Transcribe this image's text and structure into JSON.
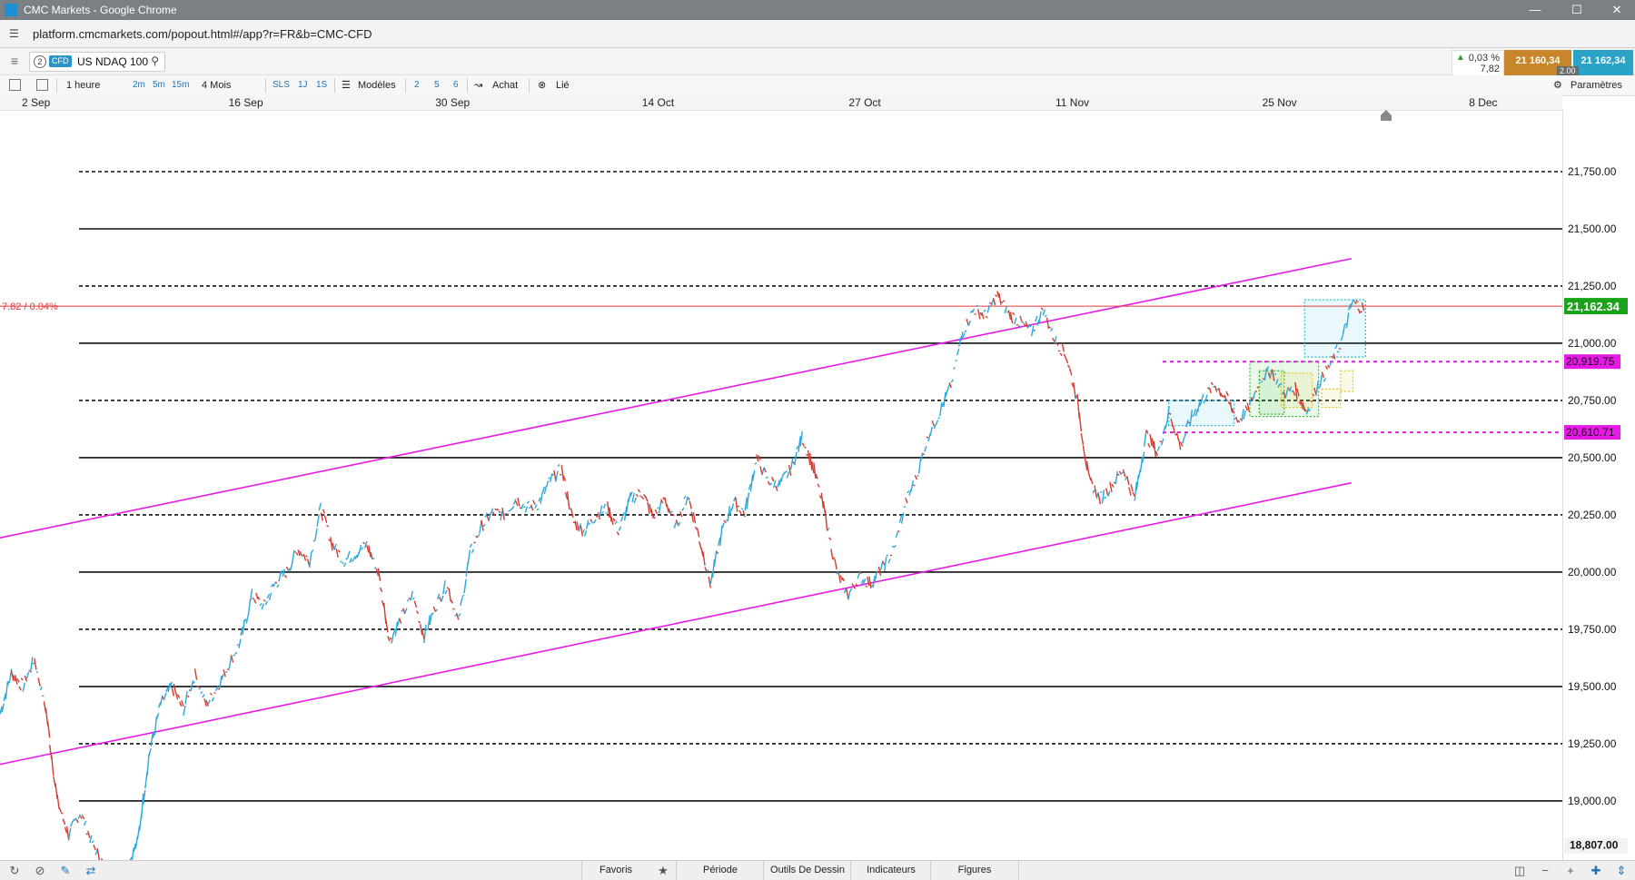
{
  "window": {
    "title": "CMC Markets - Google Chrome",
    "controls": [
      "—",
      "☐",
      "✕"
    ]
  },
  "address": {
    "url": "platform.cmcmarkets.com/popout.html#/app?r=FR&b=CMC-CFD"
  },
  "instrument": {
    "number": "2",
    "tag": "CFD",
    "name": "US NDAQ 100"
  },
  "quote": {
    "change_pct": "0,03 %",
    "change_abs": "7,82",
    "sell": "21 160,34",
    "buy": "21 162,34",
    "spread": "2.00"
  },
  "toolbar": {
    "interval": "1 heure",
    "intervals": [
      "2m",
      "5m",
      "15m"
    ],
    "range": "4 Mois",
    "sl": "SLS",
    "day": "1J",
    "one_s": "1S",
    "templates": "Modèles",
    "counts": [
      "2",
      "5",
      "6"
    ],
    "buy": "Achat",
    "linked": "Lié",
    "settings": "Paramètres"
  },
  "bottom": {
    "tabs": [
      "Favoris",
      "Période",
      "Outils De Dessin",
      "Indicateurs",
      "Figures"
    ]
  },
  "chart_data": {
    "type": "line",
    "instrument": "US NDAQ 100",
    "x_labels": [
      "2 Sep",
      "16 Sep",
      "30 Sep",
      "14 Oct",
      "27 Oct",
      "11 Nov",
      "25 Nov",
      "8 Dec"
    ],
    "y_labels": [
      "21,750.00",
      "21,500.00",
      "21,250.00",
      "21,000.00",
      "20,750.00",
      "20,500.00",
      "20,250.00",
      "20,000.00",
      "19,750.00",
      "19,500.00",
      "19,250.00",
      "19,000.00"
    ],
    "ylim": [
      18807,
      22000
    ],
    "solid_levels": [
      21500,
      21000,
      20500,
      20000,
      19500,
      19000
    ],
    "dashed_levels": [
      21750,
      21250,
      20750,
      20250,
      19750,
      19250
    ],
    "current_price": {
      "value": 21162.34,
      "label": "21,162.34",
      "change_label": "7.82 / 0.04%",
      "color": "#1aa31a"
    },
    "magenta_levels": [
      {
        "value": 20919.75,
        "label": "20,919.75"
      },
      {
        "value": 20610.71,
        "label": "20,610.71"
      }
    ],
    "low_label": {
      "value": 18807,
      "label": "18,807.00"
    },
    "channel": {
      "color": "#e619e6",
      "upper": [
        [
          0,
          20150
        ],
        [
          0.865,
          21370
        ]
      ],
      "lower": [
        [
          0,
          19160
        ],
        [
          0.865,
          20390
        ]
      ]
    },
    "series": [
      {
        "name": "US NDAQ 100",
        "values": [
          19380,
          19560,
          19500,
          19620,
          19400,
          19000,
          18850,
          18950,
          18820,
          18720,
          18620,
          18700,
          18820,
          19200,
          19420,
          19500,
          19400,
          19550,
          19420,
          19500,
          19600,
          19700,
          19900,
          19850,
          19950,
          20000,
          20100,
          20050,
          20280,
          20120,
          20050,
          20080,
          20120,
          20000,
          19700,
          19800,
          19900,
          19720,
          19850,
          19950,
          19780,
          20080,
          20200,
          20260,
          20250,
          20320,
          20280,
          20300,
          20400,
          20450,
          20220,
          20180,
          20250,
          20280,
          20180,
          20320,
          20350,
          20240,
          20320,
          20200,
          20340,
          20150,
          19950,
          20180,
          20310,
          20260,
          20500,
          20400,
          20380,
          20450,
          20590,
          20450,
          20250,
          20000,
          19900,
          19980,
          19950,
          20020,
          20100,
          20300,
          20420,
          20600,
          20700,
          20820,
          21050,
          21150,
          21120,
          21210,
          21130,
          21090,
          21050,
          21150,
          21020,
          20950,
          20750,
          20400,
          20320,
          20380,
          20450,
          20320,
          20600,
          20520,
          20700,
          20550,
          20680,
          20760,
          20820,
          20760,
          20660,
          20720,
          20850,
          20880,
          20780,
          20800,
          20700,
          20820,
          20900,
          21000,
          21180,
          21150
        ]
      }
    ],
    "overlay_boxes": [
      {
        "x0": 0.748,
        "x1": 0.79,
        "y0": 20640,
        "y1": 20750,
        "color": "#29b6d6"
      },
      {
        "x0": 0.8,
        "x1": 0.844,
        "y0": 20680,
        "y1": 20920,
        "color": "#2fb82f"
      },
      {
        "x0": 0.806,
        "x1": 0.822,
        "y0": 20690,
        "y1": 20880,
        "color": "#2fb82f"
      },
      {
        "x0": 0.82,
        "x1": 0.84,
        "y0": 20720,
        "y1": 20870,
        "color": "#e6c619"
      },
      {
        "x0": 0.835,
        "x1": 0.874,
        "y0": 20940,
        "y1": 21190,
        "color": "#29b6d6"
      },
      {
        "x0": 0.846,
        "x1": 0.858,
        "y0": 20720,
        "y1": 20800,
        "color": "#e6c619"
      },
      {
        "x0": 0.858,
        "x1": 0.866,
        "y0": 20790,
        "y1": 20880,
        "color": "#e6c619"
      }
    ]
  }
}
